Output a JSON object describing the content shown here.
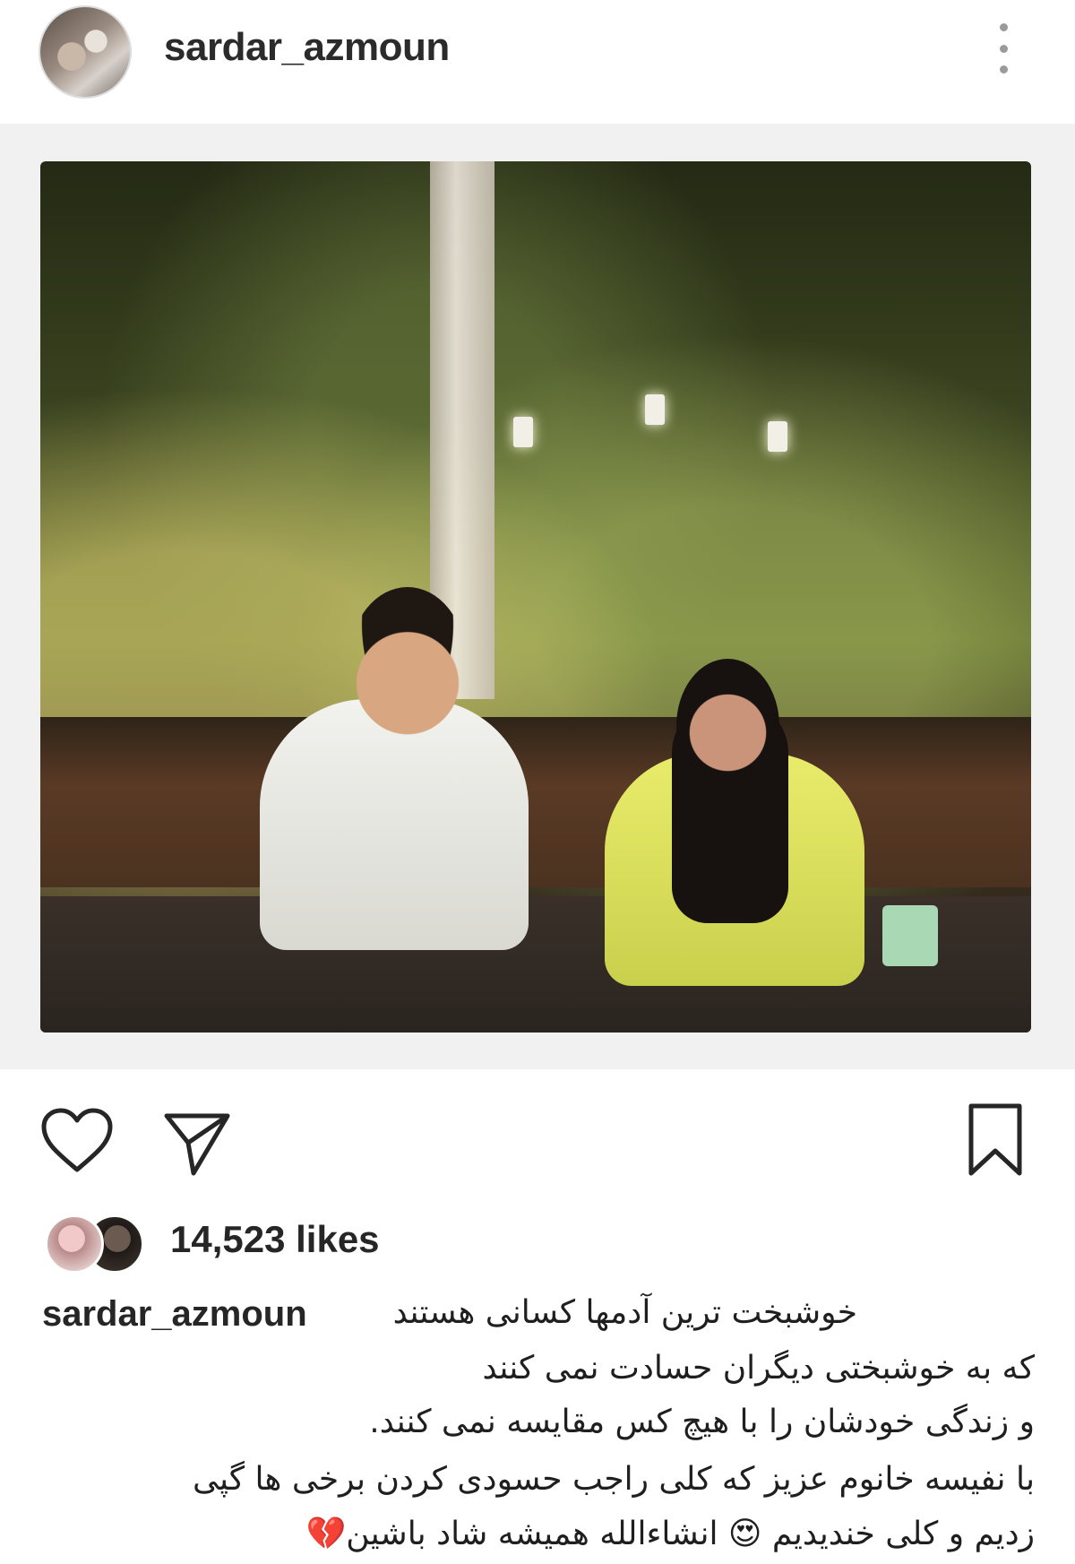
{
  "header": {
    "username": "sardar_azmoun",
    "avatar_icon": "profile-avatar",
    "more_icon": "vertical-ellipsis-icon"
  },
  "post": {
    "photo_description_icon": "post-photo"
  },
  "actions": {
    "like_icon": "heart-outline-icon",
    "share_icon": "paper-plane-icon",
    "save_icon": "bookmark-outline-icon"
  },
  "likes": {
    "count_text": "14,523 likes"
  },
  "caption": {
    "username": "sardar_azmoun",
    "lines": [
      "خوشبخت ترین آدمها کسانی هستند",
      "که به خوشبختی دیگران حسادت نمی کنند",
      "و زندگی خودشان را با هیچ کس مقایسه نمی کنند.",
      "با نفیسه خانوم عزیز که کلی راجب  حسودی کردن برخی ها گپی",
      "زدیم و کلی خندیدیم 😍 انشاءالله همیشه شاد باشین💔"
    ]
  },
  "colors": {
    "text": "#262626",
    "background": "#ffffff",
    "media_background": "#f1f1f1",
    "icon_stroke": "#262626"
  }
}
